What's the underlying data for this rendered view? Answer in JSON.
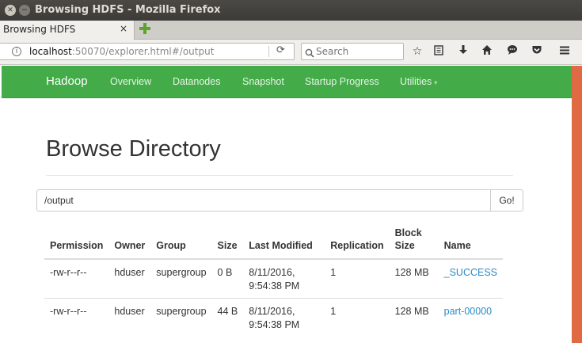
{
  "window": {
    "title": "Browsing HDFS - Mozilla Firefox",
    "close_glyph": "✕",
    "minimize_glyph": "−"
  },
  "tab": {
    "label": "Browsing HDFS",
    "close_glyph": "×"
  },
  "navbar": {
    "url_host": "localhost",
    "url_rest": ":50070/explorer.html#/output",
    "search_placeholder": "Search"
  },
  "hadoop_nav": {
    "brand": "Hadoop",
    "links": [
      "Overview",
      "Datanodes",
      "Snapshot",
      "Startup Progress",
      "Utilities"
    ],
    "utilities_caret": "▾"
  },
  "content": {
    "heading": "Browse Directory",
    "directory_value": "/output",
    "go_label": "Go!"
  },
  "table": {
    "headers": [
      "Permission",
      "Owner",
      "Group",
      "Size",
      "Last Modified",
      "Replication",
      "Block Size",
      "Name"
    ],
    "rows": [
      {
        "permission": "-rw-r--r--",
        "owner": "hduser",
        "group": "supergroup",
        "size": "0 B",
        "last_modified": "8/11/2016, 9:54:38 PM",
        "replication": "1",
        "block_size": "128 MB",
        "name": "_SUCCESS"
      },
      {
        "permission": "-rw-r--r--",
        "owner": "hduser",
        "group": "supergroup",
        "size": "44 B",
        "last_modified": "8/11/2016, 9:54:38 PM",
        "replication": "1",
        "block_size": "128 MB",
        "name": "part-00000"
      }
    ]
  },
  "colors": {
    "hadoop_green": "#43ac48",
    "link_blue": "#2a8bc8",
    "scrollbar_orange": "#e06a44"
  }
}
